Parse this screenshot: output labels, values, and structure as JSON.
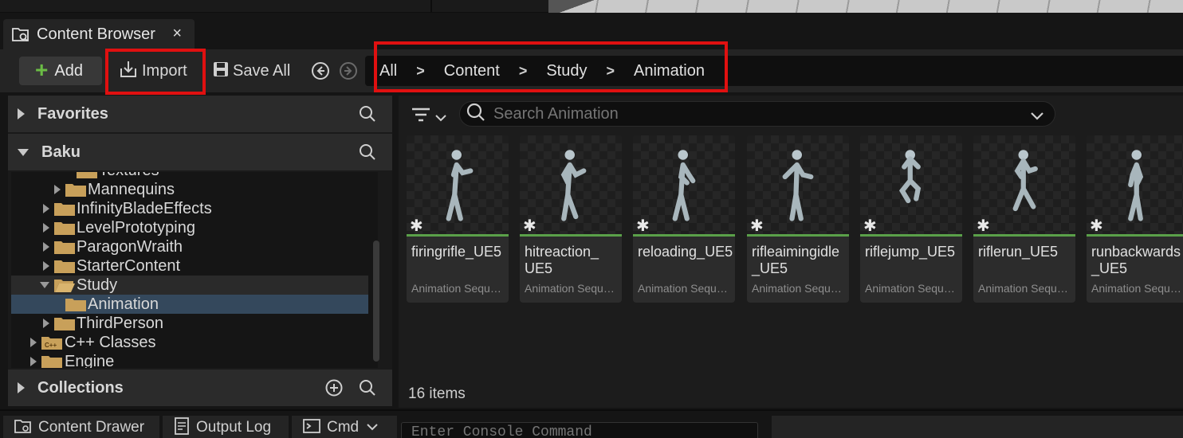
{
  "tab": {
    "title": "Content Browser",
    "close": "×"
  },
  "toolbar": {
    "add_label": "Add",
    "import_label": "Import",
    "save_all_label": "Save All"
  },
  "breadcrumb": [
    "All",
    "Content",
    "Study",
    "Animation"
  ],
  "breadcrumb_sep": ">",
  "sidebar": {
    "favorites_label": "Favorites",
    "project_label": "Baku",
    "collections_label": "Collections",
    "tree": [
      {
        "label": "Textures",
        "partial": true
      },
      {
        "label": "Mannequins"
      },
      {
        "label": "InfinityBladeEffects"
      },
      {
        "label": "LevelPrototyping"
      },
      {
        "label": "ParagonWraith"
      },
      {
        "label": "StarterContent"
      },
      {
        "label": "Study",
        "expanded": true
      },
      {
        "label": "Animation",
        "selected": true
      },
      {
        "label": "ThirdPerson"
      },
      {
        "label": "C++ Classes"
      },
      {
        "label": "Engine"
      }
    ]
  },
  "search": {
    "placeholder": "Search Animation"
  },
  "assets": [
    {
      "name": "firingrifle_UE5",
      "type": "Animation Sequence"
    },
    {
      "name": "hitreaction_UE5",
      "type": "Animation Sequence"
    },
    {
      "name": "reloading_UE5",
      "type": "Animation Sequence"
    },
    {
      "name": "rifleaimingidle_UE5",
      "type": "Animation Sequence"
    },
    {
      "name": "riflejump_UE5",
      "type": "Animation Sequence"
    },
    {
      "name": "riflerun_UE5",
      "type": "Animation Sequence"
    },
    {
      "name": "runbackwards_UE5",
      "type": "Animation Sequence"
    }
  ],
  "asset_names_wrapped": {
    "hitreaction": [
      "hitreaction_",
      "UE5"
    ],
    "rifleaimingidle": [
      "rifleaimingidle",
      "_UE5"
    ],
    "runbackwards": [
      "runbackwards",
      "_UE5"
    ]
  },
  "item_count": "16 items",
  "statusbar": {
    "content_drawer": "Content Drawer",
    "output_log": "Output Log",
    "cmd": "Cmd",
    "console_placeholder": "Enter Console Command"
  },
  "colors": {
    "highlight": "#e01010",
    "add_plus": "#6bbd45",
    "asset_bar": "#5aa049",
    "folder": "#c8a05a",
    "selected_row": "#34485c"
  }
}
